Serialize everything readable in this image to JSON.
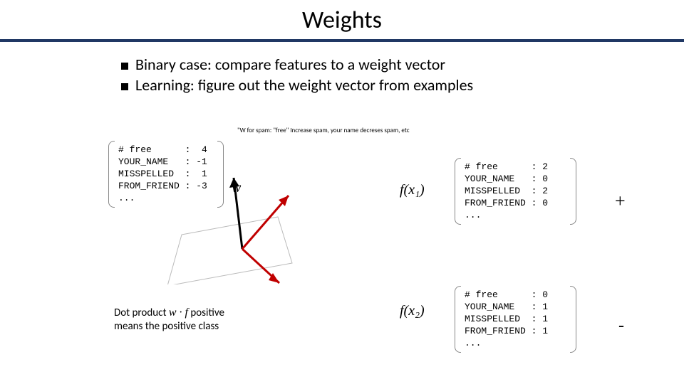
{
  "title": "Weights",
  "bullets": [
    "Binary case: compare features to a weight vector",
    "Learning: figure out the weight vector from examples"
  ],
  "annotation": "\"W for spam: \"free\" Increase spam, your name decreses spam, etc",
  "math": {
    "w": "w",
    "fx1": "f(x₁)",
    "fx2": "f(x₂)",
    "wf": "w · f"
  },
  "vectors": {
    "weights": "# free      :  4\nYOUR_NAME   : -1\nMISSPELLED  :  1\nFROM_FRIEND : -3\n...",
    "fx1": "# free      : 2\nYOUR_NAME   : 0\nMISSPELLED  : 2\nFROM_FRIEND : 0\n...",
    "fx2": "# free      : 0\nYOUR_NAME   : 1\nMISSPELLED  : 1\nFROM_FRIEND : 1\n..."
  },
  "dotprod_line1": "Dot product ",
  "dotprod_line2": " positive",
  "dotprod_line3": "means the positive class",
  "labels": {
    "plus": "+",
    "minus": "-"
  }
}
